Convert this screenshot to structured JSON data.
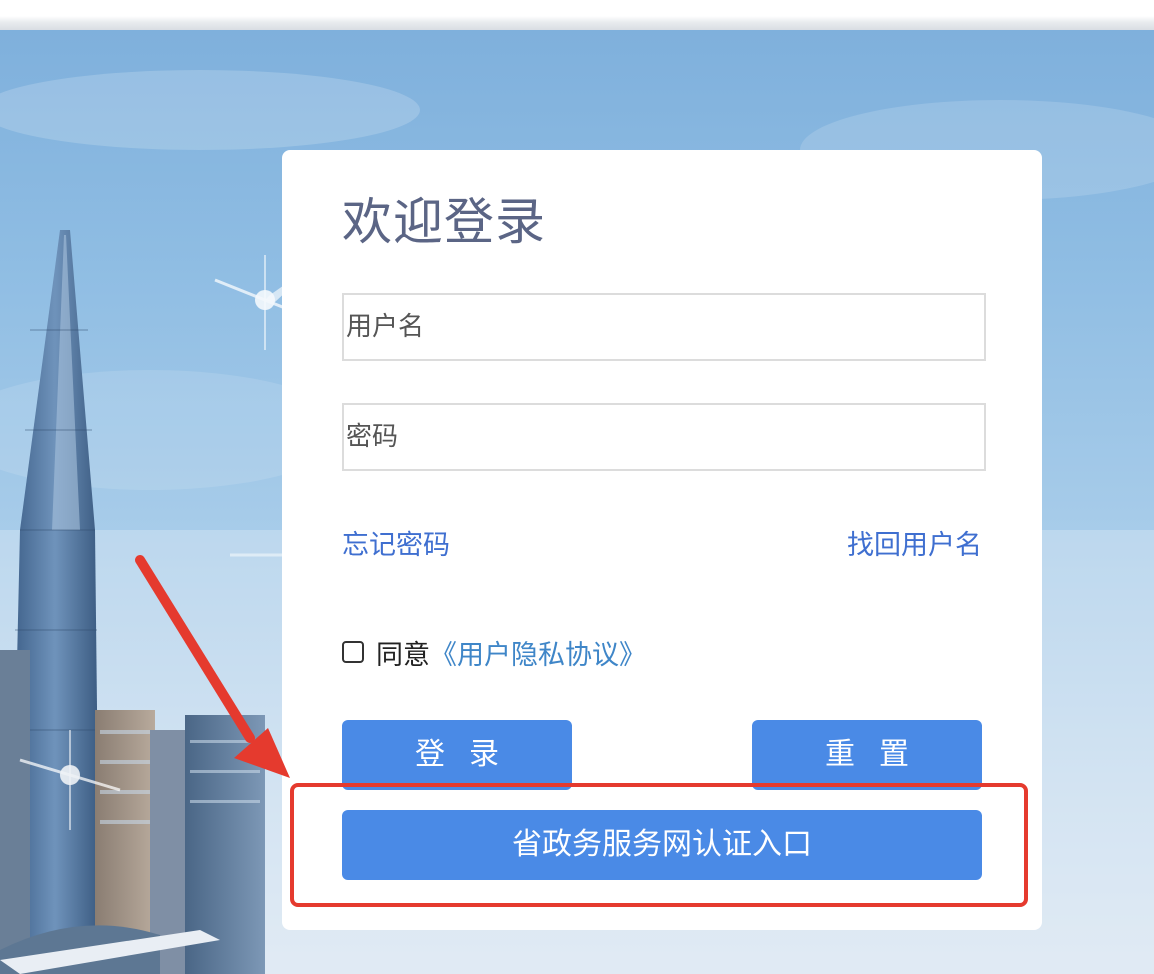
{
  "login": {
    "title": "欢迎登录",
    "username_placeholder": "用户名",
    "password_placeholder": "密码",
    "forgot_password": "忘记密码",
    "retrieve_username": "找回用户名",
    "agree_text": "同意",
    "agreement_link": "《用户隐私协议》",
    "agreement_checked": false,
    "login_button": "登录",
    "reset_button": "重置",
    "gov_auth_button": "省政务服务网认证入口"
  },
  "annotation": {
    "color": "#e53a2e"
  },
  "colors": {
    "button": "#4a8ae6",
    "link": "#3f6fd0",
    "title": "#5b6585"
  }
}
